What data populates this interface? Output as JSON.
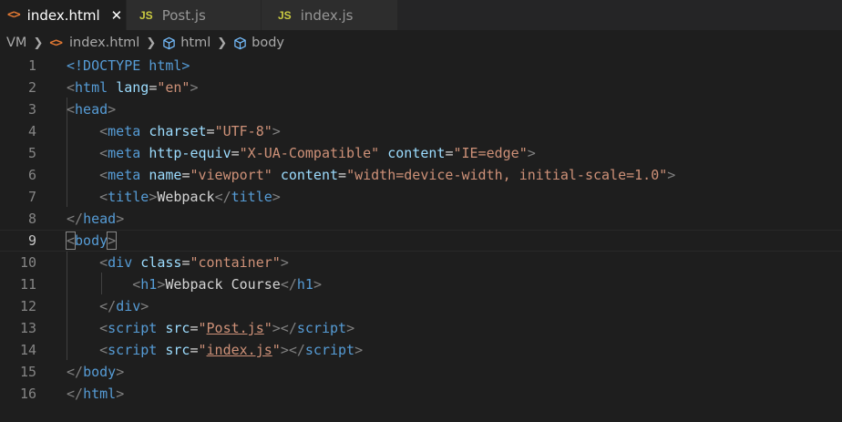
{
  "tabs": [
    {
      "label": "index.html",
      "icon": "html-icon",
      "active": true
    },
    {
      "label": "Post.js",
      "icon": "js-icon",
      "active": false
    },
    {
      "label": "index.js",
      "icon": "js-icon",
      "active": false
    }
  ],
  "tab_icons": {
    "html": "<>",
    "js": "JS",
    "close": "✕"
  },
  "breadcrumb": {
    "root": "VM",
    "file": "index.html",
    "html": "html",
    "body": "body"
  },
  "code_lines": [
    {
      "n": "1",
      "tokens": [
        [
          "doc",
          "<!DOCTYPE html>"
        ]
      ]
    },
    {
      "n": "2",
      "tokens": [
        [
          "pun",
          "<"
        ],
        [
          "tag",
          "html"
        ],
        [
          "txt",
          " "
        ],
        [
          "attr",
          "lang"
        ],
        [
          "txt",
          "="
        ],
        [
          "str",
          "\"en\""
        ],
        [
          "pun",
          ">"
        ]
      ]
    },
    {
      "n": "3",
      "tokens": [
        [
          "pun",
          "<"
        ],
        [
          "tag",
          "head"
        ],
        [
          "pun",
          ">"
        ]
      ]
    },
    {
      "n": "4",
      "tokens": [
        [
          "txt",
          "    "
        ],
        [
          "pun",
          "<"
        ],
        [
          "tag",
          "meta"
        ],
        [
          "txt",
          " "
        ],
        [
          "attr",
          "charset"
        ],
        [
          "txt",
          "="
        ],
        [
          "str",
          "\"UTF-8\""
        ],
        [
          "pun",
          ">"
        ]
      ]
    },
    {
      "n": "5",
      "tokens": [
        [
          "txt",
          "    "
        ],
        [
          "pun",
          "<"
        ],
        [
          "tag",
          "meta"
        ],
        [
          "txt",
          " "
        ],
        [
          "attr",
          "http-equiv"
        ],
        [
          "txt",
          "="
        ],
        [
          "str",
          "\"X-UA-Compatible\""
        ],
        [
          "txt",
          " "
        ],
        [
          "attr",
          "content"
        ],
        [
          "txt",
          "="
        ],
        [
          "str",
          "\"IE=edge\""
        ],
        [
          "pun",
          ">"
        ]
      ]
    },
    {
      "n": "6",
      "tokens": [
        [
          "txt",
          "    "
        ],
        [
          "pun",
          "<"
        ],
        [
          "tag",
          "meta"
        ],
        [
          "txt",
          " "
        ],
        [
          "attr",
          "name"
        ],
        [
          "txt",
          "="
        ],
        [
          "str",
          "\"viewport\""
        ],
        [
          "txt",
          " "
        ],
        [
          "attr",
          "content"
        ],
        [
          "txt",
          "="
        ],
        [
          "str",
          "\"width=device-width, initial-scale=1.0\""
        ],
        [
          "pun",
          ">"
        ]
      ]
    },
    {
      "n": "7",
      "tokens": [
        [
          "txt",
          "    "
        ],
        [
          "pun",
          "<"
        ],
        [
          "tag",
          "title"
        ],
        [
          "pun",
          ">"
        ],
        [
          "txt",
          "Webpack"
        ],
        [
          "pun",
          "</"
        ],
        [
          "tag",
          "title"
        ],
        [
          "pun",
          ">"
        ]
      ]
    },
    {
      "n": "8",
      "tokens": [
        [
          "pun",
          "</"
        ],
        [
          "tag",
          "head"
        ],
        [
          "pun",
          ">"
        ]
      ]
    },
    {
      "n": "9",
      "tokens": [
        [
          "pun",
          "<"
        ],
        [
          "tag",
          "body"
        ],
        [
          "pun",
          ">"
        ]
      ]
    },
    {
      "n": "10",
      "tokens": [
        [
          "txt",
          "    "
        ],
        [
          "pun",
          "<"
        ],
        [
          "tag",
          "div"
        ],
        [
          "txt",
          " "
        ],
        [
          "attr",
          "class"
        ],
        [
          "txt",
          "="
        ],
        [
          "str",
          "\"container\""
        ],
        [
          "pun",
          ">"
        ]
      ]
    },
    {
      "n": "11",
      "tokens": [
        [
          "txt",
          "        "
        ],
        [
          "pun",
          "<"
        ],
        [
          "tag",
          "h1"
        ],
        [
          "pun",
          ">"
        ],
        [
          "txt",
          "Webpack Course"
        ],
        [
          "pun",
          "</"
        ],
        [
          "tag",
          "h1"
        ],
        [
          "pun",
          ">"
        ]
      ]
    },
    {
      "n": "12",
      "tokens": [
        [
          "txt",
          "    "
        ],
        [
          "pun",
          "</"
        ],
        [
          "tag",
          "div"
        ],
        [
          "pun",
          ">"
        ]
      ]
    },
    {
      "n": "13",
      "tokens": [
        [
          "txt",
          "    "
        ],
        [
          "pun",
          "<"
        ],
        [
          "tag",
          "script"
        ],
        [
          "txt",
          " "
        ],
        [
          "attr",
          "src"
        ],
        [
          "txt",
          "="
        ],
        [
          "str",
          "\""
        ],
        [
          "strlink",
          "Post.js"
        ],
        [
          "str",
          "\""
        ],
        [
          "pun",
          "></"
        ],
        [
          "tag",
          "script"
        ],
        [
          "pun",
          ">"
        ]
      ]
    },
    {
      "n": "14",
      "tokens": [
        [
          "txt",
          "    "
        ],
        [
          "pun",
          "<"
        ],
        [
          "tag",
          "script"
        ],
        [
          "txt",
          " "
        ],
        [
          "attr",
          "src"
        ],
        [
          "txt",
          "="
        ],
        [
          "str",
          "\""
        ],
        [
          "strlink",
          "index.js"
        ],
        [
          "str",
          "\""
        ],
        [
          "pun",
          "></"
        ],
        [
          "tag",
          "script"
        ],
        [
          "pun",
          ">"
        ]
      ]
    },
    {
      "n": "15",
      "tokens": [
        [
          "pun",
          "</"
        ],
        [
          "tag",
          "body"
        ],
        [
          "pun",
          ">"
        ]
      ]
    },
    {
      "n": "16",
      "tokens": [
        [
          "pun",
          "</"
        ],
        [
          "tag",
          "html"
        ],
        [
          "pun",
          ">"
        ]
      ]
    }
  ],
  "current_line": "9",
  "colors": {
    "tag": "#569cd6",
    "attr": "#9cdcfe",
    "string": "#ce9178",
    "punctuation": "#808080",
    "text": "#d4d4d4",
    "background": "#1e1e1e"
  }
}
